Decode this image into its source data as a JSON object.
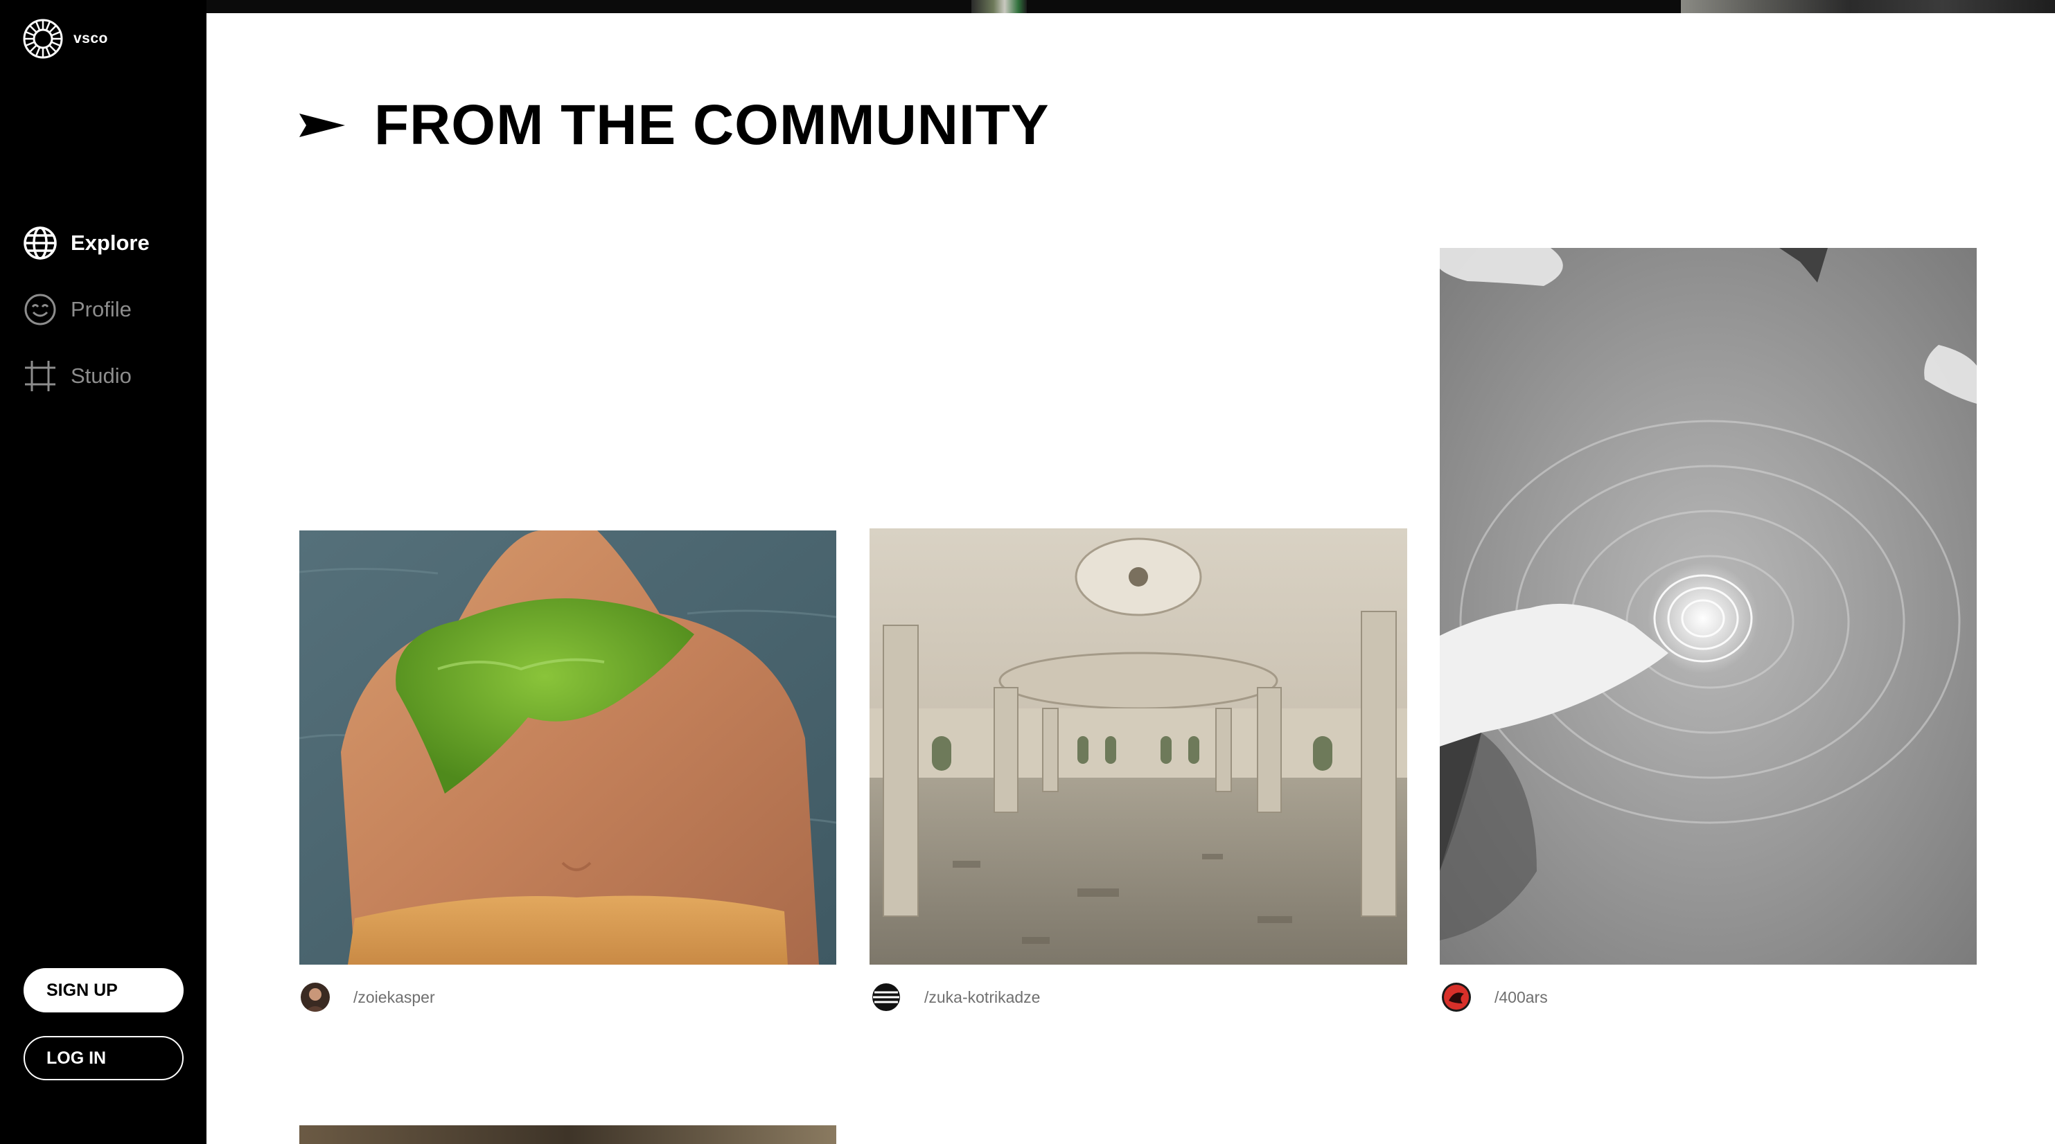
{
  "app": {
    "logo_text": "vsco"
  },
  "sidebar": {
    "nav": [
      {
        "label": "Explore",
        "icon": "globe-icon",
        "active": true
      },
      {
        "label": "Profile",
        "icon": "smiley-face-icon",
        "active": false
      },
      {
        "label": "Studio",
        "icon": "crop-frame-icon",
        "active": false
      }
    ],
    "signup_label": "SIGN UP",
    "login_label": "LOG IN"
  },
  "main": {
    "heading": "FROM THE COMMUNITY",
    "heading_icon": "pennant-arrow-icon",
    "posts": [
      {
        "handle": "/zoiekasper",
        "image": "woman wearing seaweed necklace by the water"
      },
      {
        "handle": "/zuka-kotrikadze",
        "image": "abandoned ornate hall with columns"
      },
      {
        "handle": "/400ars",
        "image": "hand touching water ripples, black and white"
      }
    ]
  },
  "colors": {
    "sidebar_bg": "#000000",
    "active_nav": "#ffffff",
    "inactive_nav": "#8d8d8d",
    "handle_text": "#6f6f6f"
  }
}
